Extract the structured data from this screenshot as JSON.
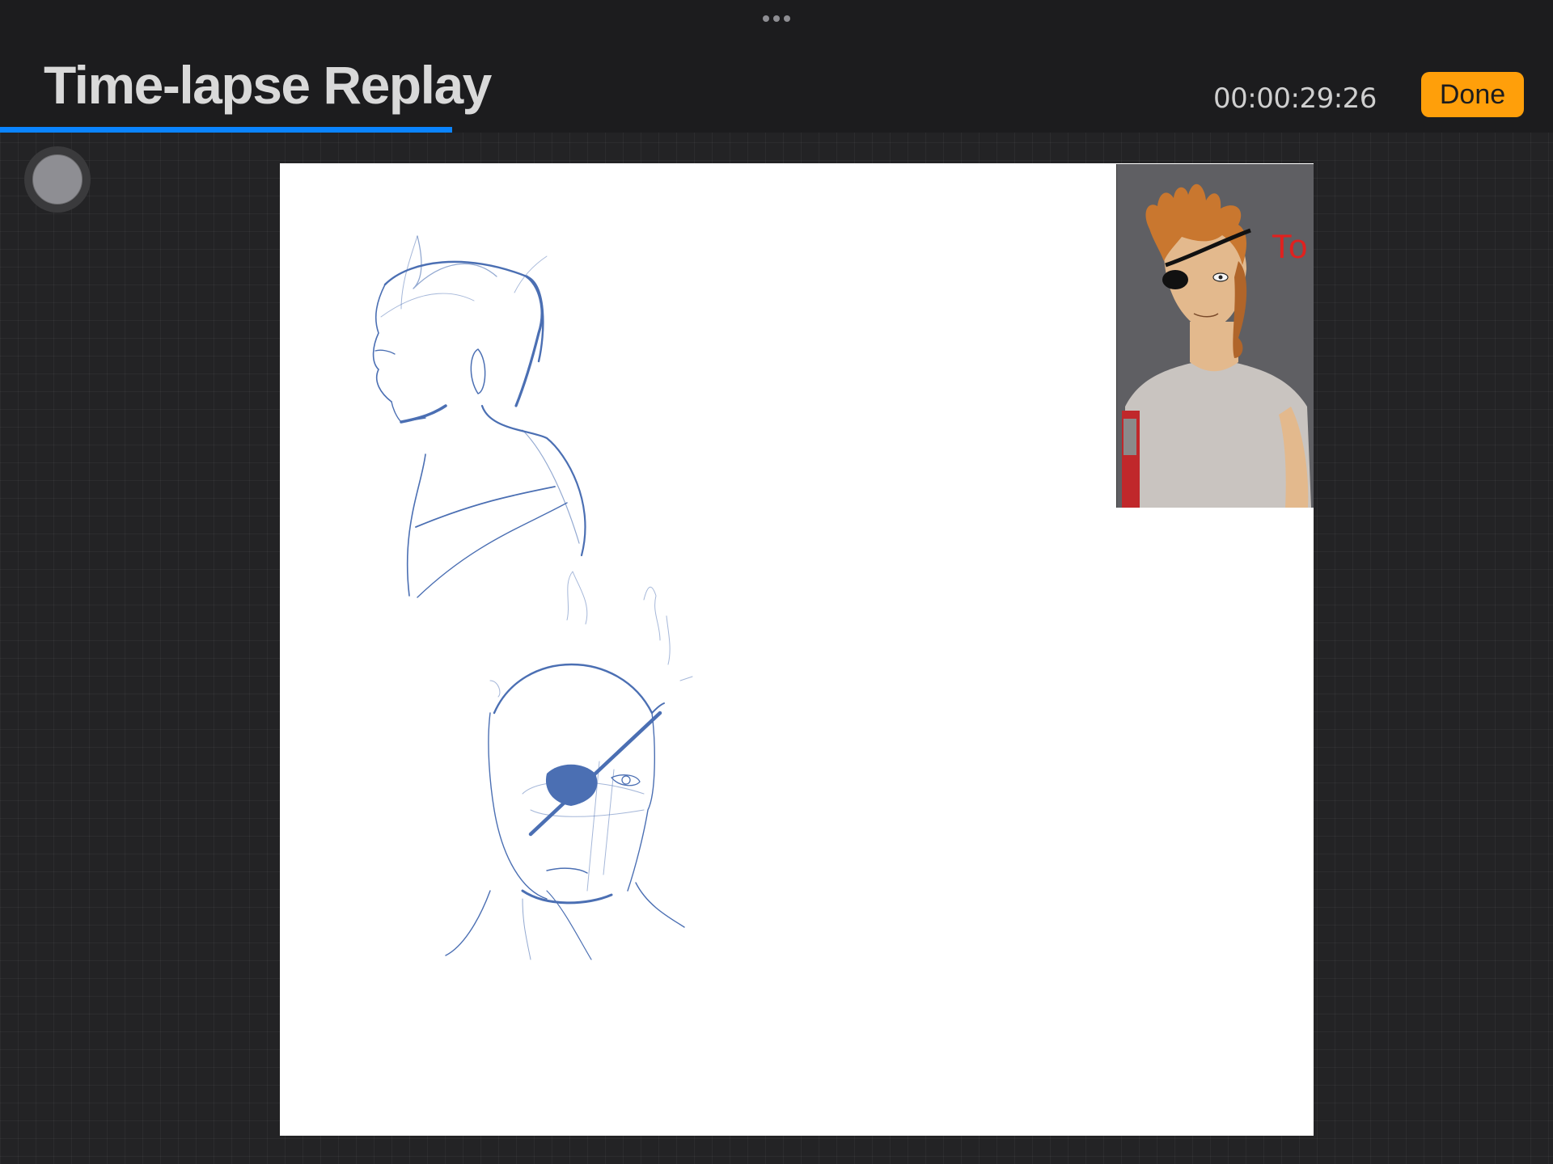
{
  "header": {
    "title": "Time-lapse Replay",
    "timecode": "00:00:29:26",
    "done_label": "Done"
  },
  "playback": {
    "progress_fraction": 0.291
  },
  "reference_image": {
    "label": "To"
  },
  "colors": {
    "accent_progress": "#0a84ff",
    "done_button": "#ff9f0a",
    "sketch_stroke": "#4b6fb3"
  },
  "icons": {
    "top_grabber": "ellipsis-icon",
    "side_control": "circle-button-icon"
  }
}
